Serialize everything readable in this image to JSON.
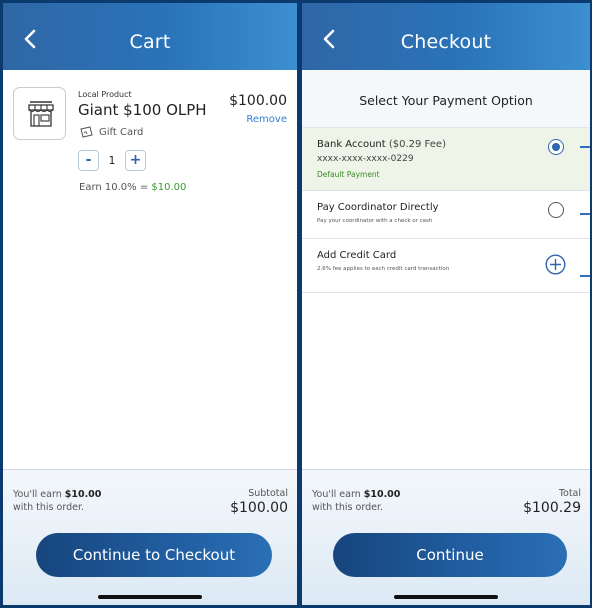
{
  "cart": {
    "header": {
      "title": "Cart"
    },
    "item": {
      "category": "Local Product",
      "name": "Giant $100 OLPH",
      "type": "Gift Card",
      "price": "$100.00",
      "remove_label": "Remove",
      "quantity": "1",
      "decrement_label": "-",
      "increment_label": "+",
      "earn_text": "Earn 10.0% = ",
      "earn_amount": "$10.00"
    },
    "footer": {
      "earn_prefix": "You'll earn ",
      "earn_amount": "$10.00",
      "earn_suffix": "with this order.",
      "subtotal_label": "Subtotal",
      "subtotal_value": "$100.00",
      "cta_label": "Continue to Checkout"
    }
  },
  "checkout": {
    "header": {
      "title": "Checkout"
    },
    "heading": "Select Your Payment Option",
    "options": [
      {
        "title": "Bank Account",
        "fee": " ($0.29 Fee)",
        "subtitle": "xxxx-xxxx-xxxx-0229",
        "note": "Default Payment",
        "selected": true
      },
      {
        "title": "Pay Coordinator Directly",
        "subtitle": "Pay your coordinator with a check or cash",
        "selected": false
      },
      {
        "title": "Add Credit Card",
        "subtitle": "2.6% fee applies to each credit card transaction",
        "icon": "plus-circle-icon"
      }
    ],
    "footer": {
      "earn_prefix": "You'll earn ",
      "earn_amount": "$10.00",
      "earn_suffix": "with this order.",
      "total_label": "Total",
      "total_value": "$100.29",
      "cta_label": "Continue"
    }
  },
  "colors": {
    "header_start": "#2f67a6",
    "header_end": "#3c8fd0",
    "button": "#1f5a9c",
    "link": "#2f7fd4",
    "earn_green": "#3a9a2f",
    "selected_option_bg": "#eef4e7"
  }
}
